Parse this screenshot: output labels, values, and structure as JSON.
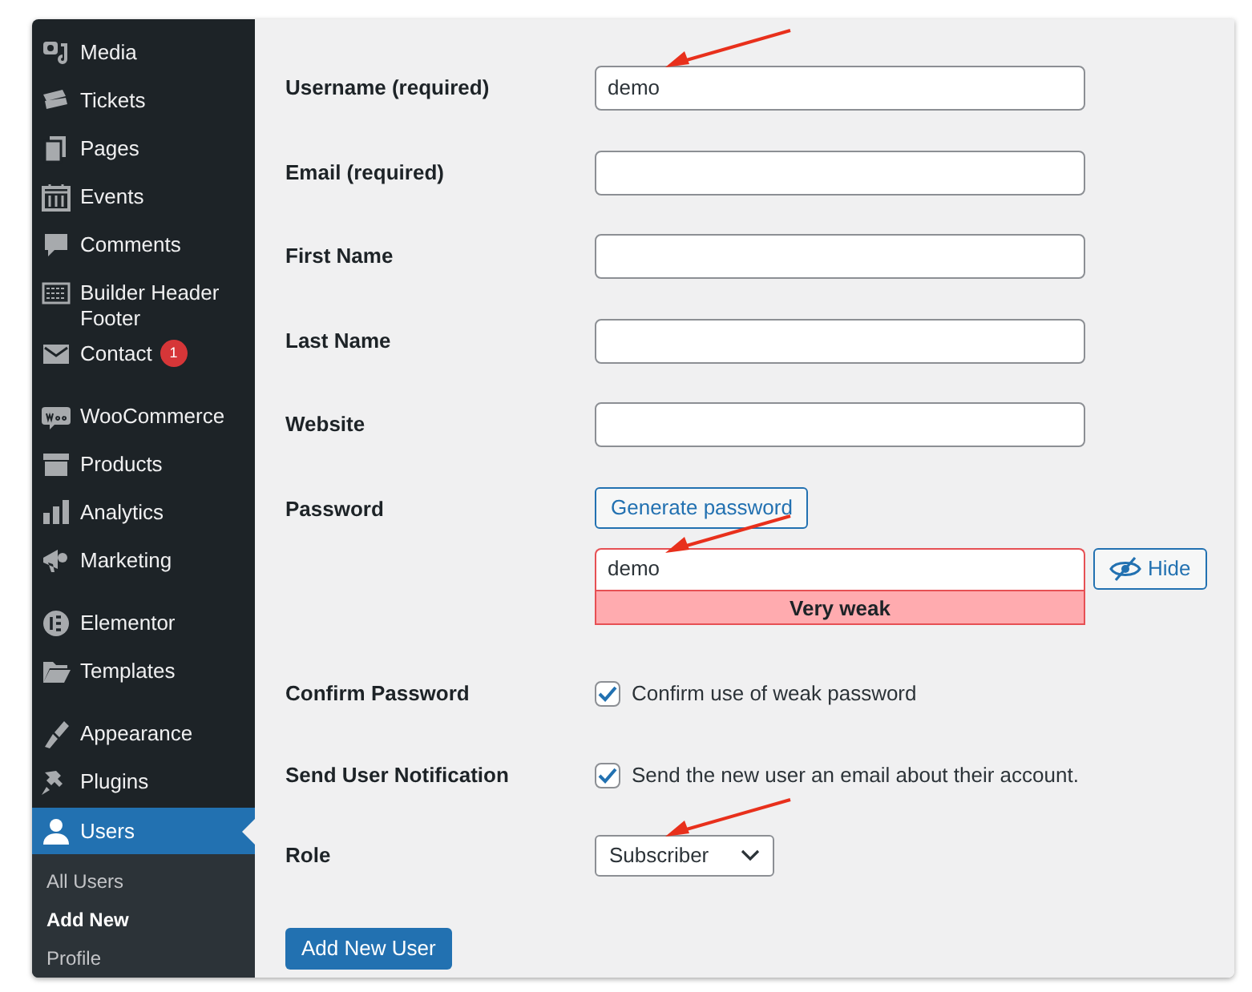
{
  "sidebar": {
    "groups": [
      [
        {
          "label": "Media",
          "selected": false
        },
        {
          "label": "Tickets",
          "selected": false
        },
        {
          "label": "Pages",
          "selected": false
        },
        {
          "label": "Events",
          "selected": false
        },
        {
          "label": "Comments",
          "selected": false
        },
        {
          "label": "Builder Header Footer",
          "selected": false
        },
        {
          "label": "Contact",
          "badge": "1",
          "selected": false
        }
      ],
      [
        {
          "label": "WooCommerce",
          "selected": false
        },
        {
          "label": "Products",
          "selected": false
        },
        {
          "label": "Analytics",
          "selected": false
        },
        {
          "label": "Marketing",
          "selected": false
        }
      ],
      [
        {
          "label": "Elementor",
          "selected": false
        },
        {
          "label": "Templates",
          "selected": false
        }
      ],
      [
        {
          "label": "Appearance",
          "selected": false
        },
        {
          "label": "Plugins",
          "selected": false
        },
        {
          "label": "Users",
          "selected": true,
          "submenu": [
            {
              "label": "All Users",
              "selected": false
            },
            {
              "label": "Add New",
              "selected": true
            },
            {
              "label": "Profile",
              "selected": false
            }
          ]
        }
      ]
    ]
  },
  "form": {
    "rows": [
      {
        "kind": "text",
        "label": "Username (required)",
        "value": "demo",
        "annotated": true
      },
      {
        "kind": "text",
        "label": "Email (required)"
      },
      {
        "kind": "text",
        "label": "First Name"
      },
      {
        "kind": "text",
        "label": "Last Name"
      },
      {
        "kind": "text",
        "label": "Website"
      },
      {
        "kind": "password",
        "label": "Password",
        "generate_button": "Generate password",
        "value": "demo",
        "strength": "Very weak",
        "toggle_button": "Hide",
        "annotated": true
      },
      {
        "kind": "checkbox",
        "label": "Confirm Password",
        "text": "Confirm use of weak password",
        "checked": true
      },
      {
        "kind": "checkbox",
        "label": "Send User Notification",
        "text": "Send the new user an email about their account.",
        "checked": true
      },
      {
        "kind": "select",
        "label": "Role",
        "value": "Subscriber",
        "annotated": true
      }
    ],
    "submit": "Add New User"
  }
}
